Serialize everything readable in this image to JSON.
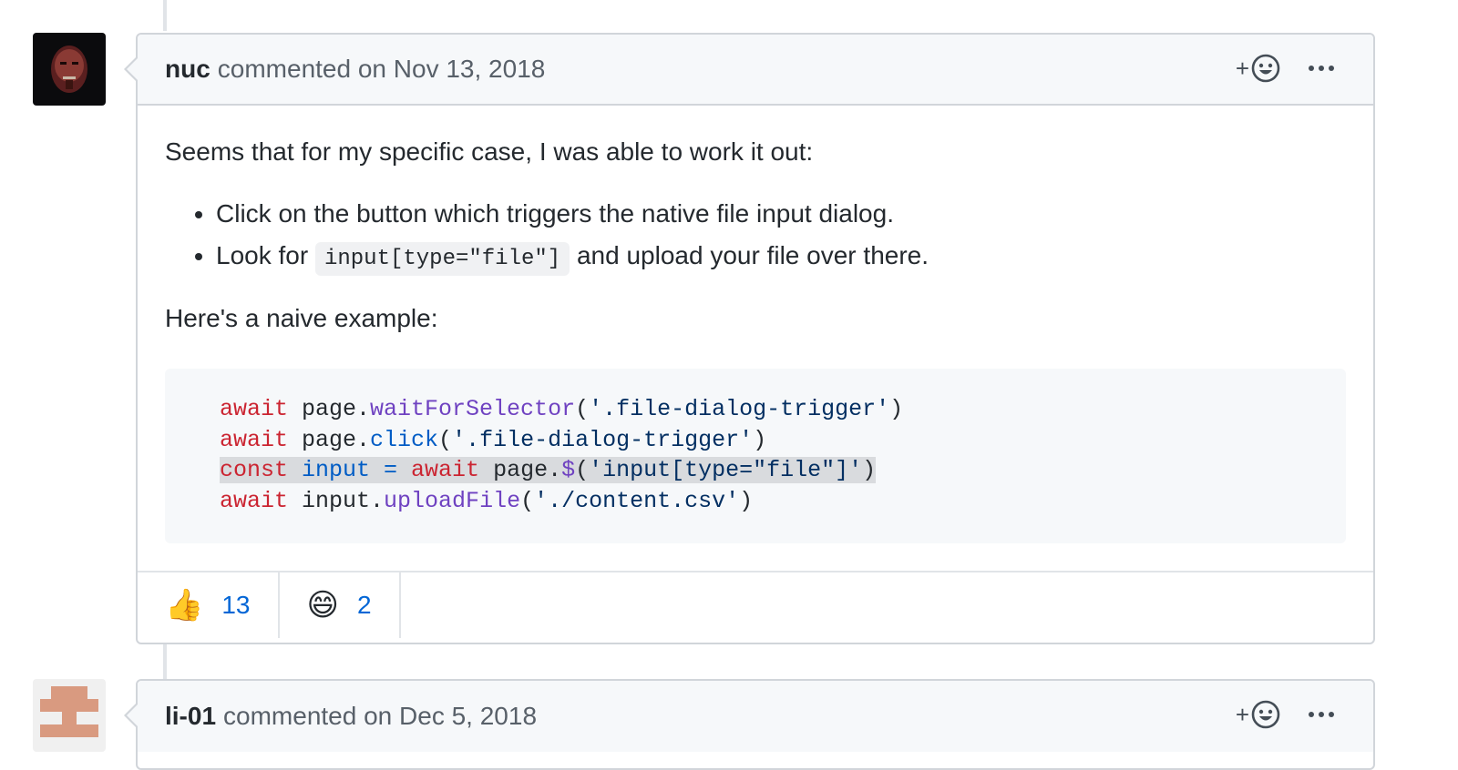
{
  "comments": [
    {
      "author": "nuc",
      "timestamp": "commented on Nov 13, 2018",
      "body": {
        "intro": "Seems that for my specific case, I was able to work it out:",
        "bullets": {
          "first": "Click on the button which triggers the native file input dialog.",
          "second_before": "Look for ",
          "second_code": "input[type=\"file\"]",
          "second_after": " and upload your file over there."
        },
        "example_label": "Here's a naive example:",
        "code": {
          "line1": {
            "kw": "await",
            "obj": " page.",
            "fn": "waitForSelector",
            "open": "(",
            "str": "'.file-dialog-trigger'",
            "close": ")"
          },
          "line2": {
            "kw": "await",
            "obj": " page.",
            "fn": "click",
            "open": "(",
            "str": "'.file-dialog-trigger'",
            "close": ")"
          },
          "line3": {
            "kw": "const",
            "var": " input",
            "eq": " = ",
            "kw2": "await",
            "obj": " page.",
            "fn": "$",
            "open": "(",
            "str": "'input[type=\"file\"]'",
            "close": ")"
          },
          "line4": {
            "kw": "await",
            "obj": " input.",
            "fn": "uploadFile",
            "open": "(",
            "str": "'./content.csv'",
            "close": ")"
          }
        }
      },
      "reactions": [
        {
          "emoji": "👍",
          "icon": "thumbs-up-icon",
          "count": "13"
        },
        {
          "emoji": "😄",
          "icon": "smile-icon",
          "count": "2"
        }
      ]
    },
    {
      "author": "li-01",
      "timestamp": "commented on Dec 5, 2018"
    }
  ],
  "header_actions": {
    "add_reaction_plus": "+",
    "add_reaction_icon": "smiley-icon",
    "more_icon": "kebab-horizontal-icon"
  },
  "colors": {
    "keyword": "#cb2431",
    "function": "#6f42c1",
    "string": "#032f62",
    "variable": "#005cc5",
    "link": "#0366d6"
  }
}
